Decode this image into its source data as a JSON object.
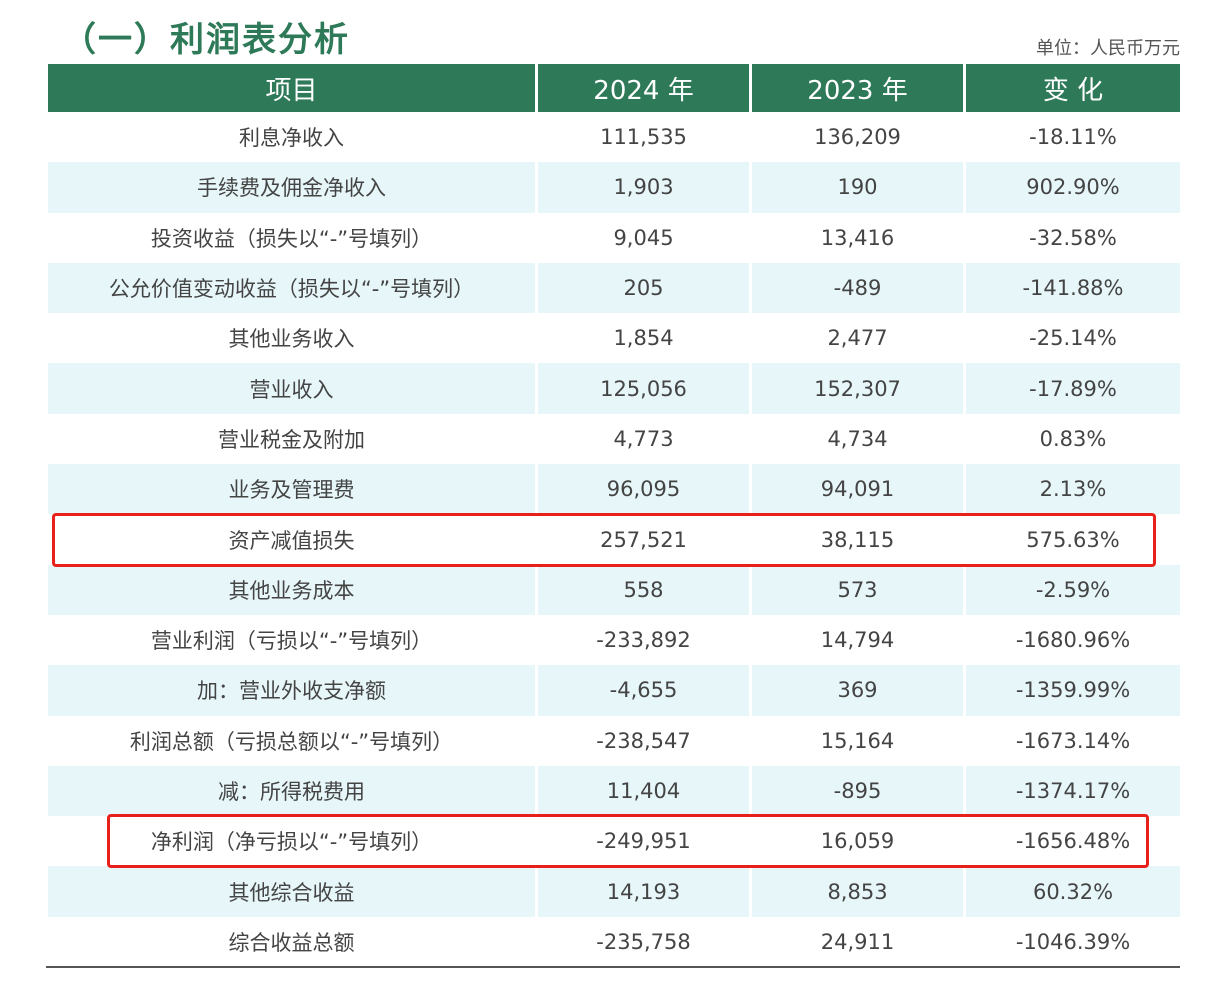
{
  "title": "（一）利润表分析",
  "unit": "单位：人民币万元",
  "headers": [
    "项目",
    "2024 年",
    "2023 年",
    "变  化"
  ],
  "rows": [
    [
      "利息净收入",
      "111,535",
      "136,209",
      "-18.11%"
    ],
    [
      "手续费及佣金净收入",
      "1,903",
      "190",
      "902.90%"
    ],
    [
      "投资收益（损失以“-”号填列）",
      "9,045",
      "13,416",
      "-32.58%"
    ],
    [
      "公允价值变动收益（损失以“-”号填列）",
      "205",
      "-489",
      "-141.88%"
    ],
    [
      "其他业务收入",
      "1,854",
      "2,477",
      "-25.14%"
    ],
    [
      "营业收入",
      "125,056",
      "152,307",
      "-17.89%"
    ],
    [
      "营业税金及附加",
      "4,773",
      "4,734",
      "0.83%"
    ],
    [
      "业务及管理费",
      "96,095",
      "94,091",
      "2.13%"
    ],
    [
      "资产减值损失",
      "257,521",
      "38,115",
      "575.63%"
    ],
    [
      "其他业务成本",
      "558",
      "573",
      "-2.59%"
    ],
    [
      "营业利润（亏损以“-”号填列）",
      "-233,892",
      "14,794",
      "-1680.96%"
    ],
    [
      "加：营业外收支净额",
      "-4,655",
      "369",
      "-1359.99%"
    ],
    [
      "利润总额（亏损总额以“-”号填列）",
      "-238,547",
      "15,164",
      "-1673.14%"
    ],
    [
      "减：所得税费用",
      "11,404",
      "-895",
      "-1374.17%"
    ],
    [
      "净利润（净亏损以“-”号填列）",
      "-249,951",
      "16,059",
      "-1656.48%"
    ],
    [
      "其他综合收益",
      "14,193",
      "8,853",
      "60.32%"
    ],
    [
      "综合收益总额",
      "-235,758",
      "24,911",
      "-1046.39%"
    ]
  ],
  "highlight_color": "#e8201a",
  "header_color": "#2e7a58",
  "stripe_color": "#e6f6f9"
}
